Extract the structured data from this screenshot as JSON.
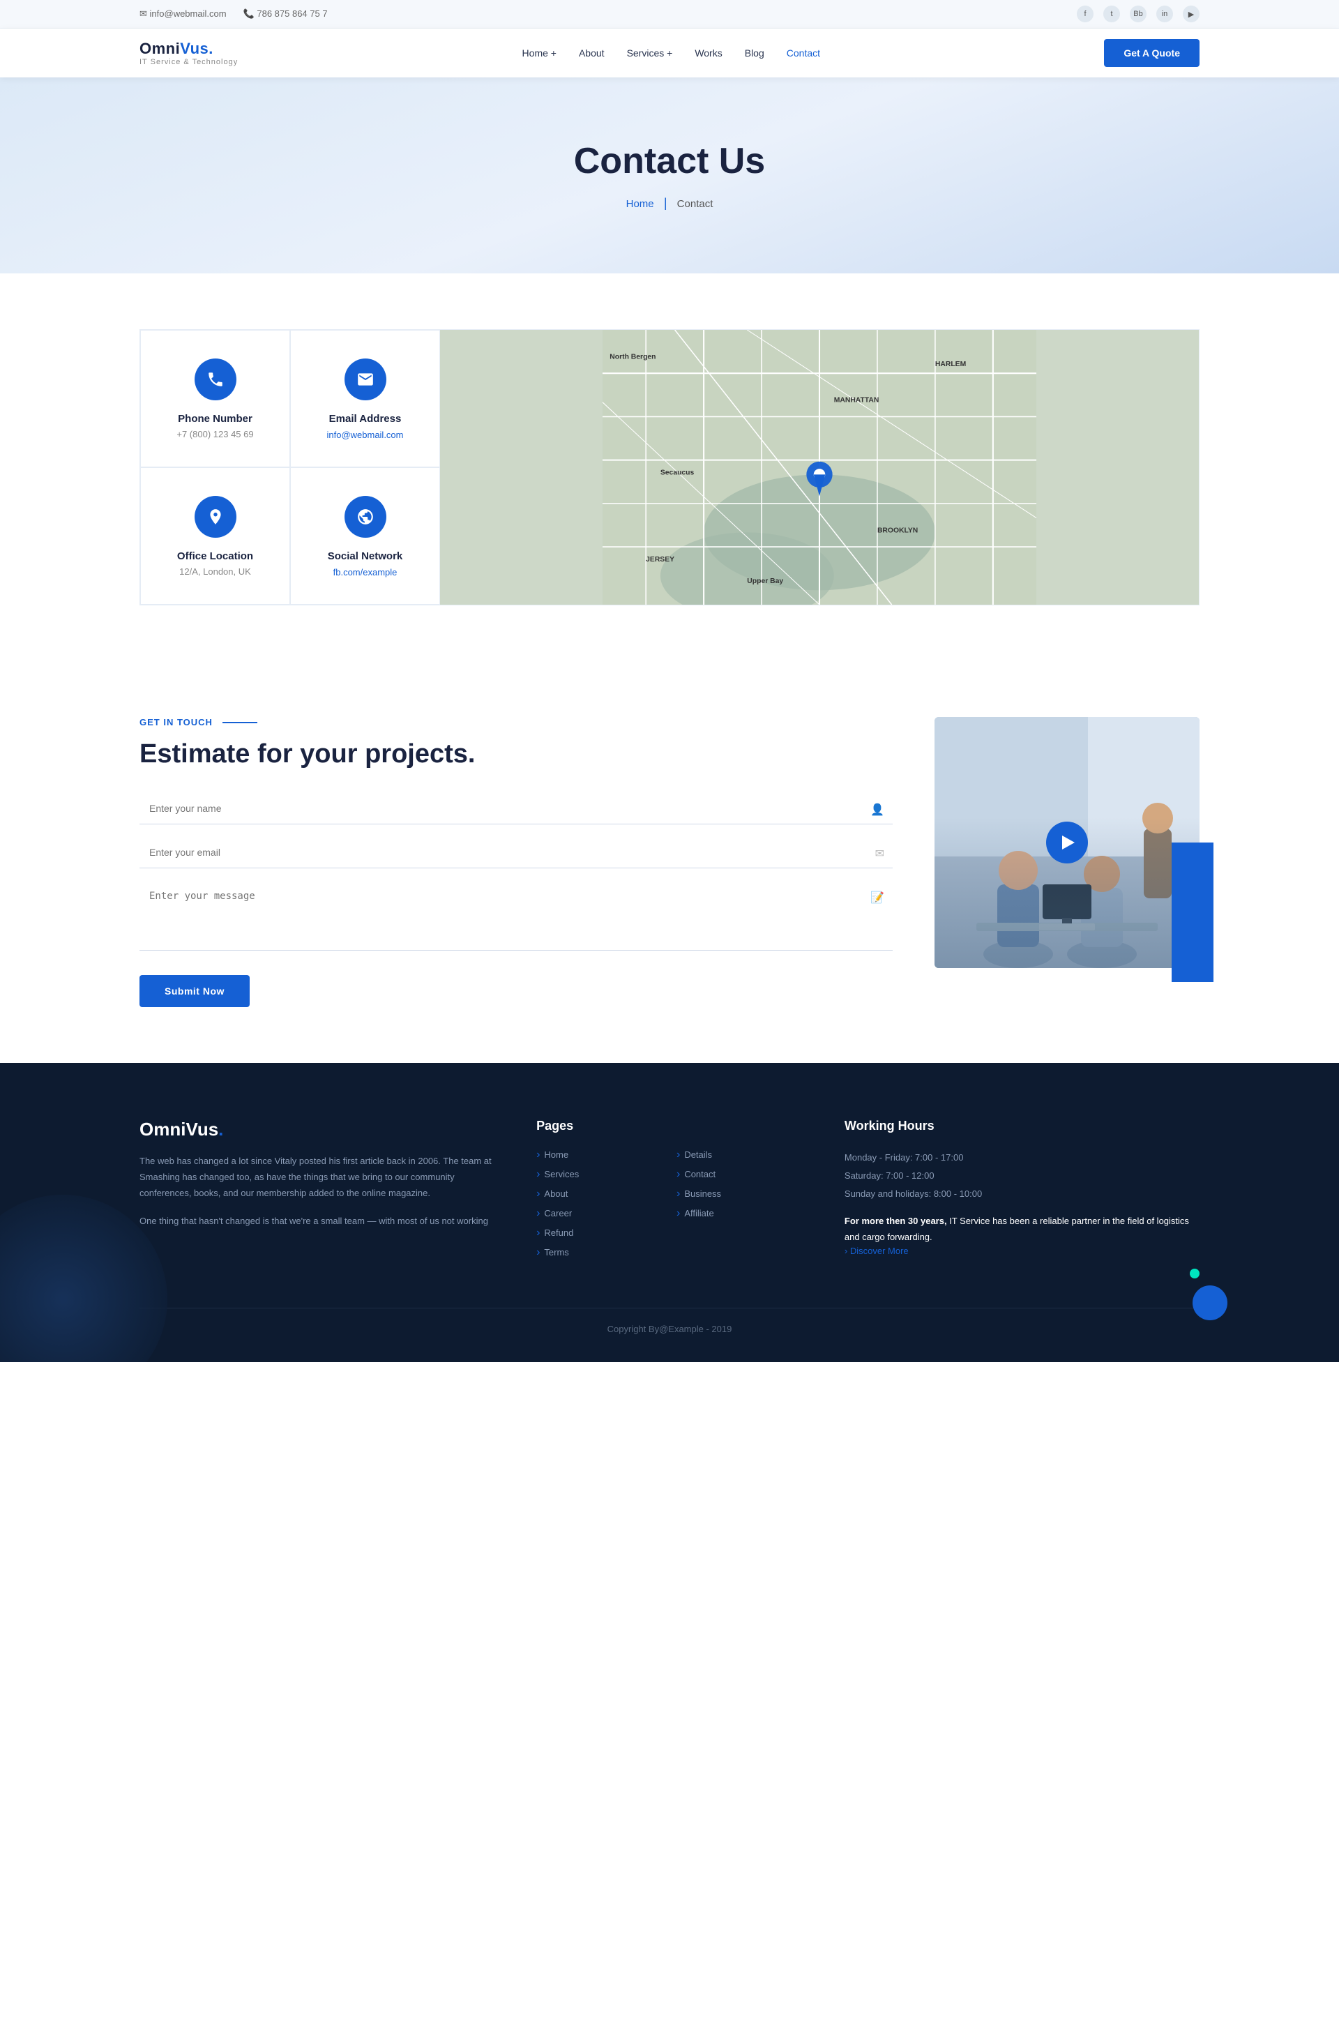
{
  "topbar": {
    "email": "info@webmail.com",
    "phone": "786 875 864 75 7",
    "email_icon": "✉",
    "phone_icon": "📞",
    "socials": [
      "f",
      "t",
      "Bb",
      "in",
      "▶"
    ]
  },
  "navbar": {
    "logo": "OmniVus.",
    "logo_sub": "IT Service & Technology",
    "links": [
      "Home +",
      "About",
      "Services +",
      "Works",
      "Blog",
      "Contact"
    ],
    "cta": "Get A Quote"
  },
  "hero": {
    "title": "Contact Us",
    "breadcrumb_home": "Home",
    "breadcrumb_current": "Contact"
  },
  "contact_cards": [
    {
      "icon": "phone",
      "title": "Phone Number",
      "value": "+7 (800) 123 45 69"
    },
    {
      "icon": "email",
      "title": "Email Address",
      "value": "info@webmail.com",
      "is_link": true
    },
    {
      "icon": "location",
      "title": "Office Location",
      "value": "12/A, London, UK"
    },
    {
      "icon": "globe",
      "title": "Social Network",
      "value": "fb.com/example",
      "is_link": true
    }
  ],
  "estimate": {
    "tag": "Get In Touch",
    "title": "Estimate for your projects.",
    "fields": {
      "name_placeholder": "Enter your name",
      "email_placeholder": "Enter your email",
      "message_placeholder": "Enter your message"
    },
    "submit_label": "Submit Now"
  },
  "footer": {
    "brand_name": "OmniVus.",
    "brand_desc_1": "The web has changed a lot since Vitaly posted his first article back in 2006. The team at Smashing has changed too, as have the things that we bring to our community conferences, books, and our membership added to the online magazine.",
    "brand_desc_2": "One thing that hasn't changed is that we're a small team — with most of us not working",
    "pages_title": "Pages",
    "pages_col1": [
      "Home",
      "Services",
      "About",
      "Career",
      "Refund",
      "Terms"
    ],
    "pages_col2": [
      "Details",
      "Contact",
      "Business",
      "Affiliate"
    ],
    "hours_title": "Working Hours",
    "hours_lines": [
      "Monday - Friday: 7:00 - 17:00",
      "Saturday: 7:00 - 12:00",
      "Sunday and holidays: 8:00 - 10:00"
    ],
    "hours_detail": "For more then 30 years, IT Service has been a reliable partner in the field of logistics and cargo forwarding.",
    "discover_link": "› Discover More",
    "copyright": "Copyright By@Example - 2019"
  }
}
